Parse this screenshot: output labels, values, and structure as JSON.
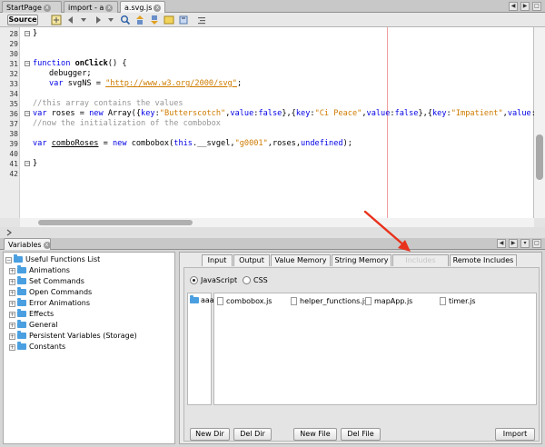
{
  "editor": {
    "tabs": [
      {
        "label": "StartPage"
      },
      {
        "label": "import - a"
      },
      {
        "label": "a.svg.js"
      }
    ],
    "toolbar": {
      "source_label": "Source"
    },
    "lines": [
      {
        "num": "28",
        "text": "}"
      },
      {
        "num": "29",
        "text": ""
      },
      {
        "num": "30",
        "text": ""
      },
      {
        "num": "31",
        "text": "function onClick() {"
      },
      {
        "num": "32",
        "text": "debugger;"
      },
      {
        "num": "33",
        "text": "var svgNS = \"http://www.w3.org/2000/svg\";"
      },
      {
        "num": "34",
        "text": ""
      },
      {
        "num": "35",
        "text": "//this array contains the values"
      },
      {
        "num": "36",
        "text": "var roses = new Array({key:\"Butterscotch\",value:false},{key:\"Ci Peace\",value:false},{key:\"Impatient\",value:false"
      },
      {
        "num": "37",
        "text": "//now the initialization of the combobox"
      },
      {
        "num": "38",
        "text": ""
      },
      {
        "num": "39",
        "text": "var comboRoses = new combobox(this.__svgel,\"g0001\",roses,undefined);"
      },
      {
        "num": "40",
        "text": ""
      },
      {
        "num": "41",
        "text": "}"
      },
      {
        "num": "42",
        "text": ""
      }
    ]
  },
  "variables_panel": {
    "tab_label": "Variables",
    "functions": {
      "root": "Useful Functions List",
      "items": [
        "Animations",
        "Set Commands",
        "Open Commands",
        "Error Animations",
        "Effects",
        "General",
        "Persistent Variables (Storage)",
        "Constants"
      ]
    },
    "tabs": [
      {
        "label": "Input"
      },
      {
        "label": "Output"
      },
      {
        "label": "Value Memory"
      },
      {
        "label": "String Memory"
      },
      {
        "label": "Includes"
      },
      {
        "label": "Remote Includes"
      }
    ],
    "radios": {
      "javascript": "JavaScript",
      "css": "CSS"
    },
    "dirs": [
      "aaa"
    ],
    "files": [
      "combobox.js",
      "helper_functions.js",
      "mapApp.js",
      "timer.js"
    ],
    "buttons": {
      "new_dir": "New Dir",
      "del_dir": "Del Dir",
      "new_file": "New File",
      "del_file": "Del File",
      "import": "Import"
    }
  },
  "colors": {
    "keyword": "#0000e6",
    "string": "#ce7b00",
    "comment": "#969696",
    "folder": "#4a9fe0",
    "annotation_arrow": "#e8321c"
  },
  "icons": {
    "folder": "folder-icon",
    "file": "file-icon",
    "fold": "fold-toggle-icon",
    "arrow": "red-arrow-annotation"
  }
}
